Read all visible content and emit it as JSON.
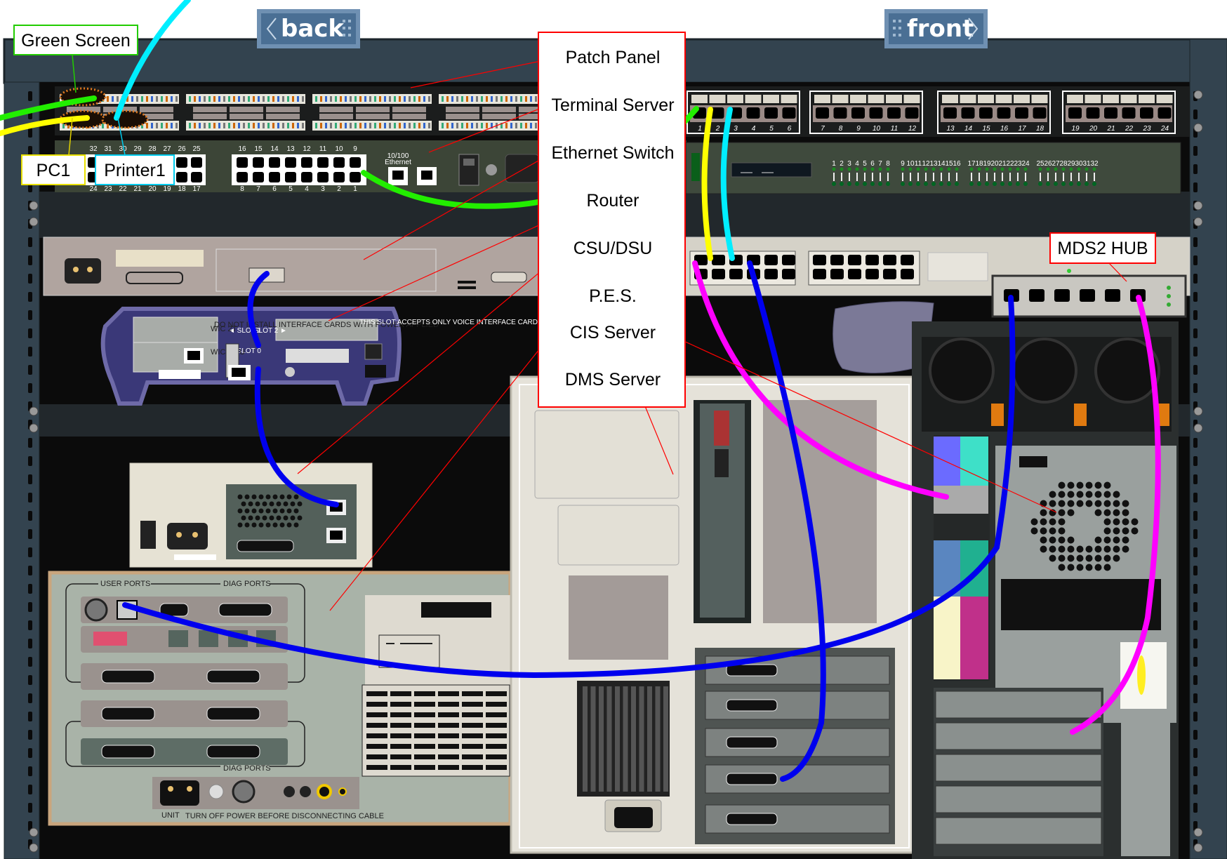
{
  "nav": {
    "back_label": "back",
    "front_label": "front"
  },
  "legend": {
    "items": [
      "Patch Panel",
      "Terminal Server",
      "Ethernet Switch",
      "Router",
      "CSU/DSU",
      "P.E.S.",
      "CIS Server",
      "DMS Server"
    ]
  },
  "callouts": {
    "green_screen": "Green Screen",
    "pc1": "PC1",
    "printer1": "Printer1",
    "mds2_hub": "MDS2 HUB"
  },
  "terminal_server": {
    "top_numbers": [
      "32",
      "31",
      "30",
      "29",
      "28",
      "27",
      "26",
      "25",
      "16",
      "15",
      "14",
      "13",
      "12",
      "11",
      "10",
      "9"
    ],
    "bottom_numbers": [
      "24",
      "23",
      "22",
      "21",
      "20",
      "19",
      "18",
      "17",
      "8",
      "7",
      "6",
      "5",
      "4",
      "3",
      "2",
      "1"
    ],
    "ethernet_label_1": "10/100",
    "ethernet_label_2": "Ethernet"
  },
  "front_patch_panel": {
    "port_numbers": [
      "1",
      "2",
      "3",
      "4",
      "5",
      "6",
      "7",
      "8",
      "9",
      "10",
      "11",
      "12",
      "13",
      "14",
      "15",
      "16",
      "17",
      "18",
      "19",
      "20",
      "21",
      "22",
      "23",
      "24"
    ]
  },
  "switch": {
    "led_numbers": [
      "1",
      "2",
      "3",
      "4",
      "5",
      "6",
      "7",
      "8",
      "9",
      "10",
      "11",
      "12",
      "13",
      "14",
      "15",
      "16",
      "17",
      "18",
      "19",
      "20",
      "21",
      "22",
      "23",
      "24",
      "25",
      "26",
      "27",
      "28",
      "29",
      "30",
      "31",
      "32"
    ]
  },
  "router": {
    "slot1": "◄ SLOT 1",
    "slot0": "◄ SLOT 0",
    "slot2": "SLOT 2 ►",
    "warning": "DO NOT INSTALL INTERFACE CARDS WITH POWER APPLIED",
    "voice_note": "THIS SLOT ACCEPTS ONLY VOICE INTERFACE CARDS",
    "wic1": "WIC 2T",
    "wic0": "WIC 1B U"
  },
  "pes": {
    "user_ports": "USER PORTS",
    "diag_ports_top": "DIAG PORTS",
    "diag_ports_bottom": "DIAG PORTS",
    "unit": "UNIT",
    "warning": "TURN OFF POWER BEFORE DISCONNECTING CABLE"
  },
  "colors": {
    "green_cable": "#22ee00",
    "yellow_cable": "#ffff00",
    "cyan_cable": "#00eeff",
    "magenta_cable": "#ff00ff",
    "blue_cable": "#0000ee",
    "leader_line": "#ff0000",
    "nav_button": "#4a6f94"
  }
}
